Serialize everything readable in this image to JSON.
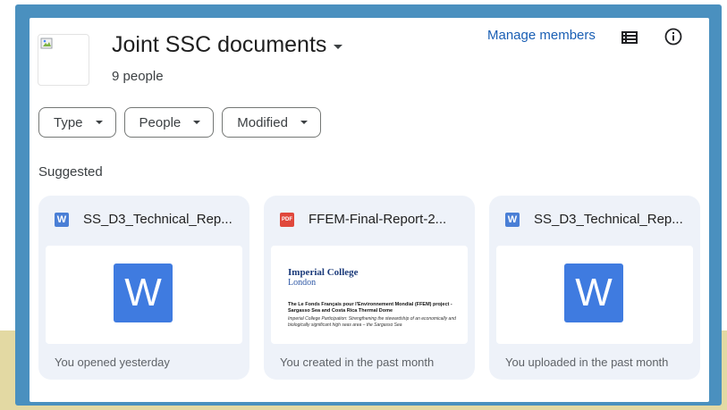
{
  "header": {
    "title": "Joint SSC documents",
    "people": "9 people",
    "manage_members": "Manage members",
    "list_view_icon": "list-view-icon",
    "info_icon": "info-icon"
  },
  "filters": [
    {
      "label": "Type"
    },
    {
      "label": "People"
    },
    {
      "label": "Modified"
    }
  ],
  "suggested_label": "Suggested",
  "cards": [
    {
      "file_type": "word",
      "name": "SS_D3_Technical_Rep...",
      "preview_letter": "W",
      "footer": "You opened yesterday"
    },
    {
      "file_type": "pdf",
      "icon_text": "PDF",
      "name": "FFEM-Final-Report-2...",
      "footer": "You created in the past month",
      "preview": {
        "org_line1": "Imperial College",
        "org_line2": "London",
        "heading": "The Le Fonds Français pour l'Environnement Mondial (FFEM) project - Sargasso Sea and Costa Rica Thermal Dome",
        "subtext": "Imperial College Participation: Strengthening the stewardship of an economically and biologically significant high seas area – the Sargasso Sea"
      }
    },
    {
      "file_type": "word",
      "name": "SS_D3_Technical_Rep...",
      "preview_letter": "W",
      "footer": "You uploaded in the past month"
    }
  ],
  "colors": {
    "frame": "#4a90bf",
    "link": "#1a5fb4",
    "card_bg": "#eef2f9",
    "word_blue": "#3f7be0",
    "pdf_red": "#e0483c",
    "band": "#e3d9a3"
  }
}
